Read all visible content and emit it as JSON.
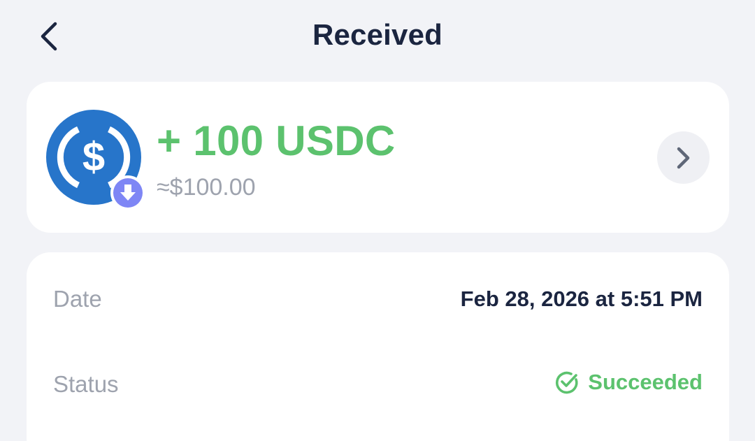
{
  "header": {
    "title": "Received",
    "back_icon": "chevron-left-icon"
  },
  "transaction": {
    "token_icon": "usdc-icon",
    "badge_icon": "arrow-down-icon",
    "amount": "+ 100 USDC",
    "fiat_value": "≈$100.00",
    "detail_icon": "chevron-right-icon"
  },
  "details": {
    "date_label": "Date",
    "date_value": "Feb 28, 2026 at 5:51 PM",
    "status_label": "Status",
    "status_value": "Succeeded",
    "status_icon": "check-circle-icon"
  },
  "colors": {
    "background": "#F2F3F7",
    "card": "#FFFFFF",
    "title": "#1B2540",
    "success": "#5CC26E",
    "muted": "#9EA3AE",
    "usdc_blue": "#2775CA",
    "badge_purple": "#7E86F5"
  }
}
